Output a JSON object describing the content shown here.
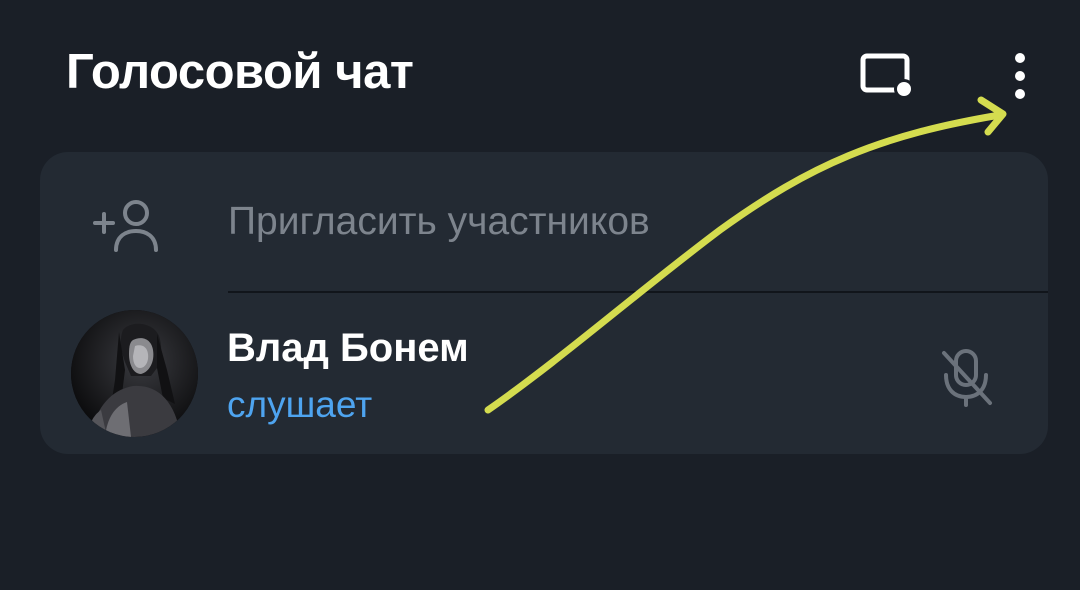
{
  "header": {
    "title": "Голосовой чат",
    "screen_share_icon": "screen-share-icon",
    "more_icon": "more-vertical-icon"
  },
  "invite": {
    "label": "Пригласить участников",
    "icon": "add-user-icon"
  },
  "participants": [
    {
      "name": "Влад Бонем",
      "status": "слушает",
      "avatar": "avatar-photo",
      "mic_icon": "mic-muted-icon"
    }
  ],
  "colors": {
    "background": "#1a1f27",
    "card": "#232a33",
    "title": "#ffffff",
    "muted_text": "#7d848d",
    "status_accent": "#4ea4f0",
    "annotation_arrow": "#d4dc4f"
  }
}
